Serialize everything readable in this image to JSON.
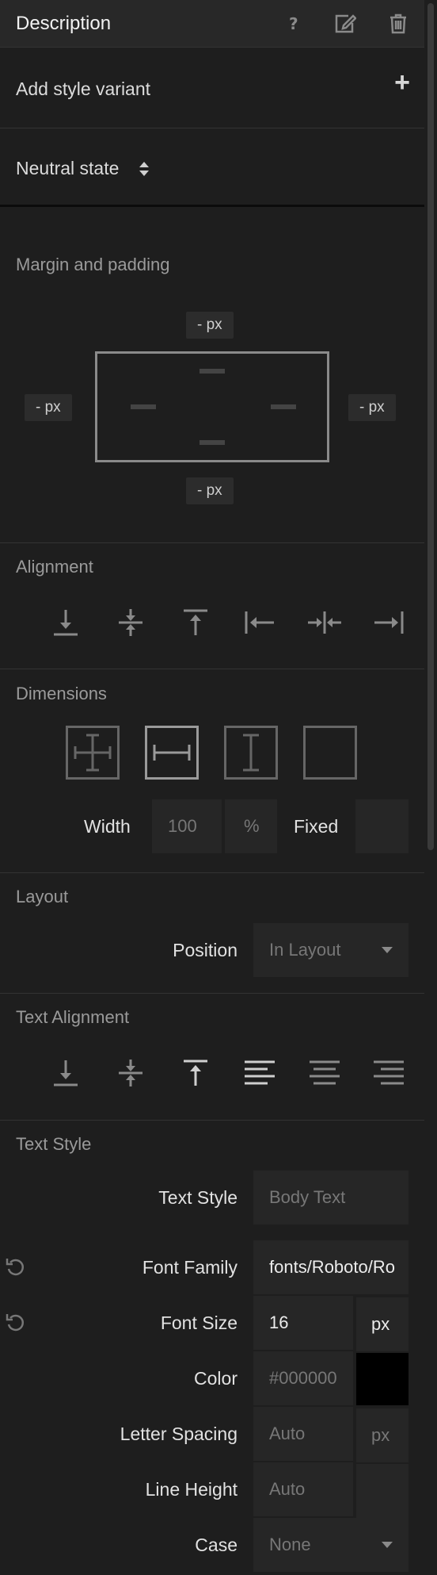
{
  "header": {
    "title": "Description",
    "icons": [
      "help-icon",
      "edit-icon",
      "trash-icon"
    ]
  },
  "style_variant": {
    "label": "Add style variant",
    "add_glyph": "+"
  },
  "state": {
    "label": "Neutral state"
  },
  "margin_padding": {
    "title": "Margin and padding",
    "top": "- px",
    "left": "- px",
    "right": "- px",
    "bottom": "- px",
    "inner_dash": "-"
  },
  "alignment": {
    "title": "Alignment",
    "icons": [
      "align-bottom-icon",
      "align-vertical-center-icon",
      "align-top-icon",
      "align-left-icon",
      "align-horizontal-center-icon",
      "align-right-icon"
    ]
  },
  "dimensions": {
    "title": "Dimensions",
    "width_label": "Width",
    "width_value": "100",
    "width_unit": "%",
    "fixed_label": "Fixed",
    "fixed_value": ""
  },
  "layout": {
    "title": "Layout",
    "position_label": "Position",
    "position_value": "In Layout"
  },
  "text_alignment": {
    "title": "Text Alignment",
    "icons": [
      "text-align-bottom-icon",
      "text-align-middle-icon",
      "text-align-top-icon",
      "text-align-left-icon",
      "text-align-center-icon",
      "text-align-right-icon"
    ]
  },
  "text_style": {
    "title": "Text Style",
    "style_label": "Text Style",
    "style_placeholder": "Body Text",
    "font_family_label": "Font Family",
    "font_family_value": "fonts/Roboto/Ro",
    "font_size_label": "Font Size",
    "font_size_value": "16",
    "font_size_unit": "px",
    "color_label": "Color",
    "color_placeholder": "#000000",
    "color_swatch": "#000000",
    "letter_spacing_label": "Letter Spacing",
    "letter_spacing_placeholder": "Auto",
    "letter_spacing_unit": "px",
    "line_height_label": "Line Height",
    "line_height_placeholder": "Auto",
    "case_label": "Case",
    "case_value": "None"
  }
}
